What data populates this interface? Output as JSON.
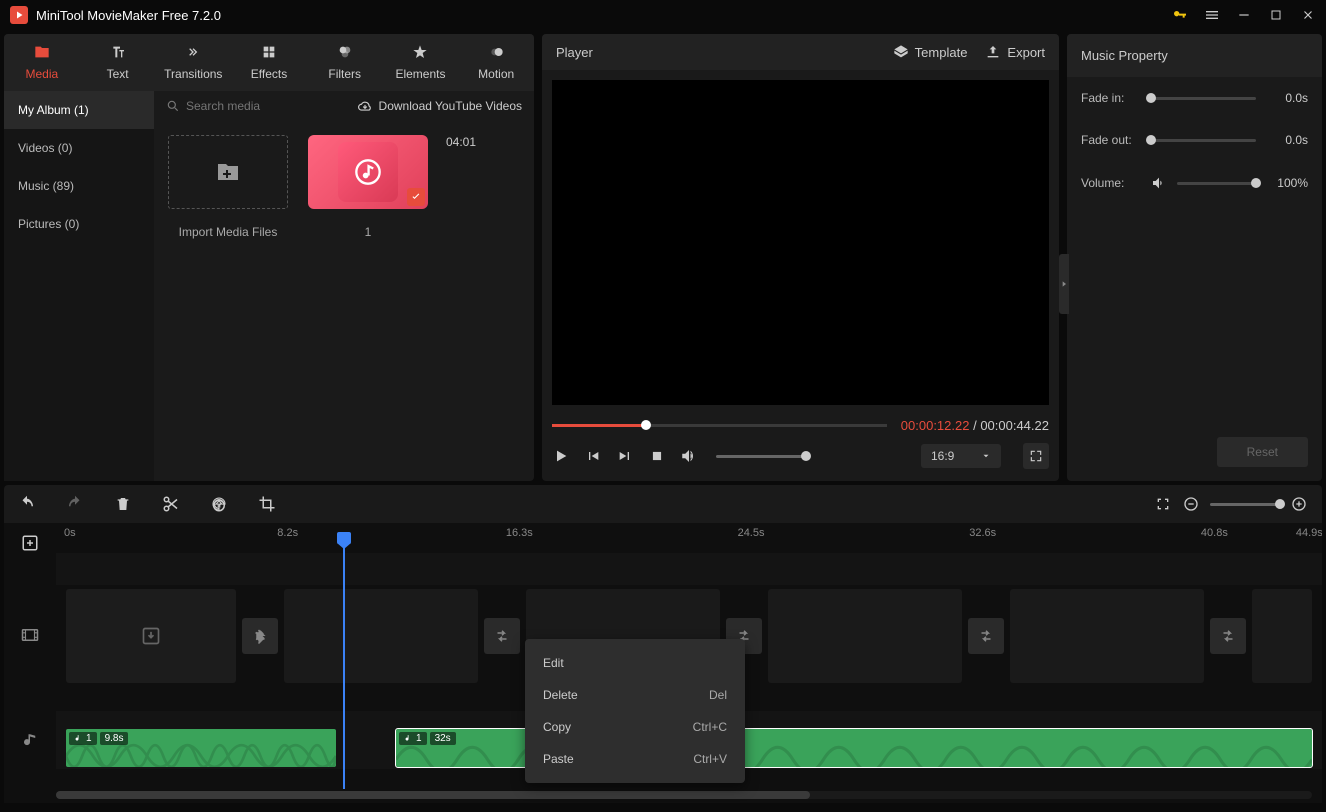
{
  "titlebar": {
    "title": "MiniTool MovieMaker Free 7.2.0"
  },
  "tabs": [
    {
      "label": "Media",
      "active": true
    },
    {
      "label": "Text"
    },
    {
      "label": "Transitions"
    },
    {
      "label": "Effects"
    },
    {
      "label": "Filters"
    },
    {
      "label": "Elements"
    },
    {
      "label": "Motion"
    }
  ],
  "sidebar": {
    "items": [
      {
        "label": "My Album (1)",
        "active": true
      },
      {
        "label": "Videos (0)"
      },
      {
        "label": "Music (89)"
      },
      {
        "label": "Pictures (0)"
      }
    ]
  },
  "search": {
    "placeholder": "Search media"
  },
  "yt_link": "Download YouTube Videos",
  "import_label": "Import Media Files",
  "media_item": {
    "duration": "04:01",
    "index": "1"
  },
  "player": {
    "title": "Player",
    "template": "Template",
    "export": "Export",
    "time_current": "00:00:12.22",
    "time_sep": " / ",
    "time_total": "00:00:44.22",
    "ratio": "16:9"
  },
  "props": {
    "title": "Music Property",
    "fade_in_label": "Fade in:",
    "fade_in_val": "0.0s",
    "fade_out_label": "Fade out:",
    "fade_out_val": "0.0s",
    "volume_label": "Volume:",
    "volume_val": "100%",
    "reset": "Reset"
  },
  "ruler": [
    "0s",
    "8.2s",
    "16.3s",
    "24.5s",
    "32.6s",
    "40.8s",
    "44.9s"
  ],
  "clip1": {
    "idx": "1",
    "dur": "9.8s"
  },
  "clip2": {
    "idx": "1",
    "dur": "32s"
  },
  "context_menu": [
    {
      "label": "Edit",
      "shortcut": ""
    },
    {
      "label": "Delete",
      "shortcut": "Del"
    },
    {
      "label": "Copy",
      "shortcut": "Ctrl+C"
    },
    {
      "label": "Paste",
      "shortcut": "Ctrl+V"
    }
  ]
}
